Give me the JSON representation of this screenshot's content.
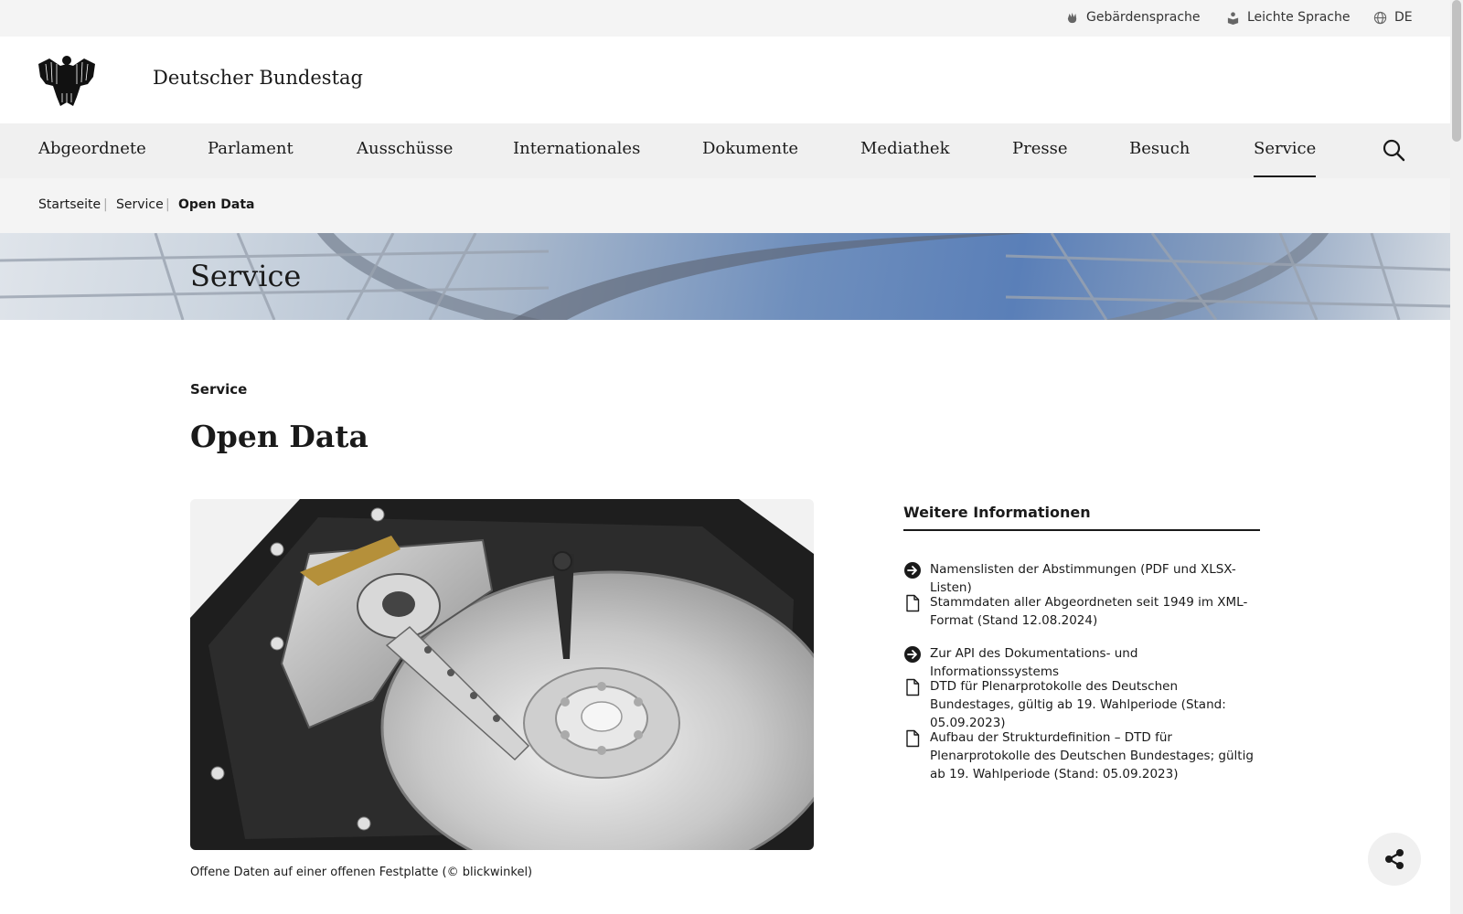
{
  "utility": {
    "sign_language": "Gebärdensprache",
    "easy_language": "Leichte Sprache",
    "language": "DE"
  },
  "header": {
    "brand": "Deutscher Bundestag"
  },
  "nav": {
    "items": [
      "Abgeordnete",
      "Parlament",
      "Ausschüsse",
      "Internationales",
      "Dokumente",
      "Mediathek",
      "Presse",
      "Besuch",
      "Service"
    ],
    "active": "Service"
  },
  "breadcrumb": {
    "items": [
      "Startseite",
      "Service",
      "Open Data"
    ]
  },
  "banner": {
    "title": "Service"
  },
  "main": {
    "kicker": "Service",
    "title": "Open Data",
    "image_caption": "Offene Daten auf einer offenen Festplatte (© blickwinkel)"
  },
  "sidebar": {
    "title": "Weitere Informationen",
    "links": [
      {
        "icon": "arrow-right-circle-icon",
        "label": "Namenslisten der Abstimmungen (PDF und XLSX-Listen)"
      },
      {
        "icon": "document-icon",
        "label": "Stammdaten aller Abgeordneten seit 1949 im XML-Format (Stand 12.08.2024)"
      },
      {
        "icon": "arrow-right-circle-icon",
        "label": "Zur API des Dokumentations- und Informationssystems"
      },
      {
        "icon": "document-icon",
        "label": "DTD für Plenarprotokolle des Deutschen Bundestages, gültig ab 19. Wahlperiode (Stand: 05.09.2023)"
      },
      {
        "icon": "document-icon",
        "label": "Aufbau der Strukturdefinition – DTD für Plenarprotokolle des Deutschen Bundestages; gültig ab 19. Wahlperiode (Stand: 05.09.2023)"
      }
    ]
  },
  "colors": {
    "text": "#1a1a1a",
    "nav_bg": "#f0f0f0",
    "util_bg": "#f4f4f4"
  }
}
